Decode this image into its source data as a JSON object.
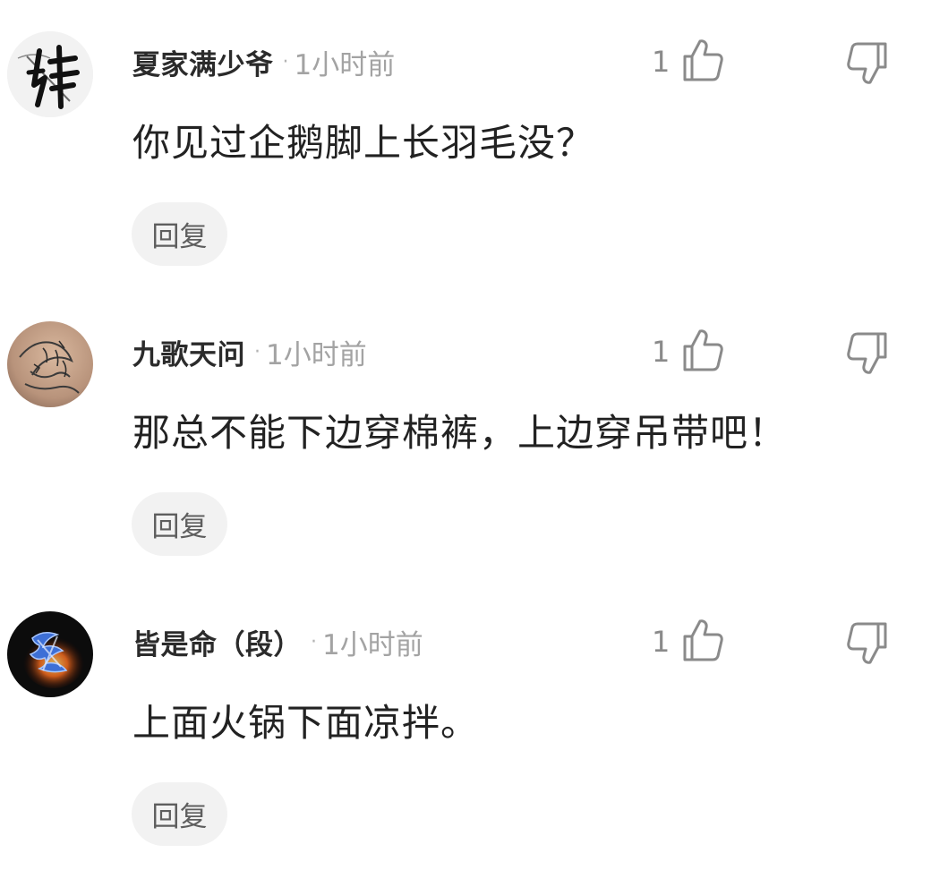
{
  "comments": [
    {
      "username": "夏家满少爷",
      "separator": "·",
      "time": "1小时前",
      "like_count": "1",
      "text": "你见过企鹅脚上长羽毛没？",
      "reply_label": "回复",
      "avatar": "calligraphy-avatar"
    },
    {
      "username": "九歌天问",
      "separator": "·",
      "time": "1小时前",
      "like_count": "1",
      "text": "那总不能下边穿棉裤，上边穿吊带吧！",
      "reply_label": "回复",
      "avatar": "tattoo-photo-avatar"
    },
    {
      "username": "皆是命（段）",
      "separator": "·",
      "time": "1小时前",
      "like_count": "1",
      "text": "上面火锅下面凉拌。",
      "reply_label": "回复",
      "avatar": "flame-glyph-avatar"
    }
  ],
  "icons": {
    "like": "thumbs-up-icon",
    "dislike": "thumbs-down-icon"
  },
  "colors": {
    "username": "#2b2b2b",
    "timestamp": "#a3a3a3",
    "body_text": "#222222",
    "reply_button_bg": "#f2f2f2",
    "icon_stroke": "#8a8a8a"
  }
}
